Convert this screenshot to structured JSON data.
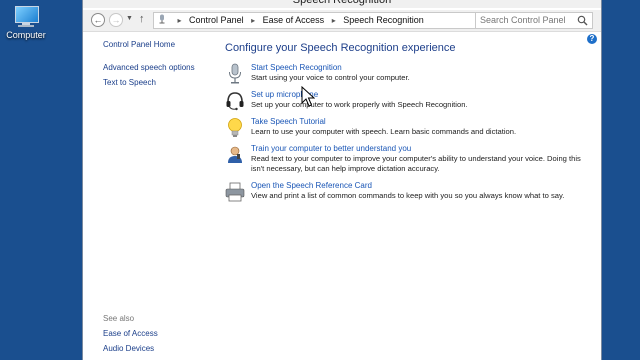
{
  "desktop": {
    "icon_label": "Computer"
  },
  "window": {
    "title": "Speech Recognition",
    "address_crumbs": [
      "Control Panel",
      "Ease of Access",
      "Speech Recognition"
    ],
    "search_placeholder": "Search Control Panel"
  },
  "sidebar": {
    "items": [
      "Control Panel Home",
      "Advanced speech options",
      "Text to Speech"
    ],
    "see_also_header": "See also",
    "see_also": [
      "Ease of Access",
      "Audio Devices"
    ]
  },
  "main": {
    "heading": "Configure your Speech Recognition experience",
    "tasks": [
      {
        "link": "Start Speech Recognition",
        "desc": "Start using your voice to control your computer.",
        "icon": "microphone-icon"
      },
      {
        "link": "Set up microphone",
        "desc": "Set up your computer to work properly with Speech Recognition.",
        "icon": "headset-icon"
      },
      {
        "link": "Take Speech Tutorial",
        "desc": "Learn to use your computer with speech.  Learn basic commands and dictation.",
        "icon": "lightbulb-icon"
      },
      {
        "link": "Train your computer to better understand you",
        "desc": "Read text to your computer to improve your computer's ability to understand your voice.  Doing this isn't necessary, but can help improve dictation accuracy.",
        "icon": "user-speaking-icon"
      },
      {
        "link": "Open the Speech Reference Card",
        "desc": "View and print a list of common commands to keep with you so you always know what to say.",
        "icon": "printer-icon"
      }
    ]
  }
}
